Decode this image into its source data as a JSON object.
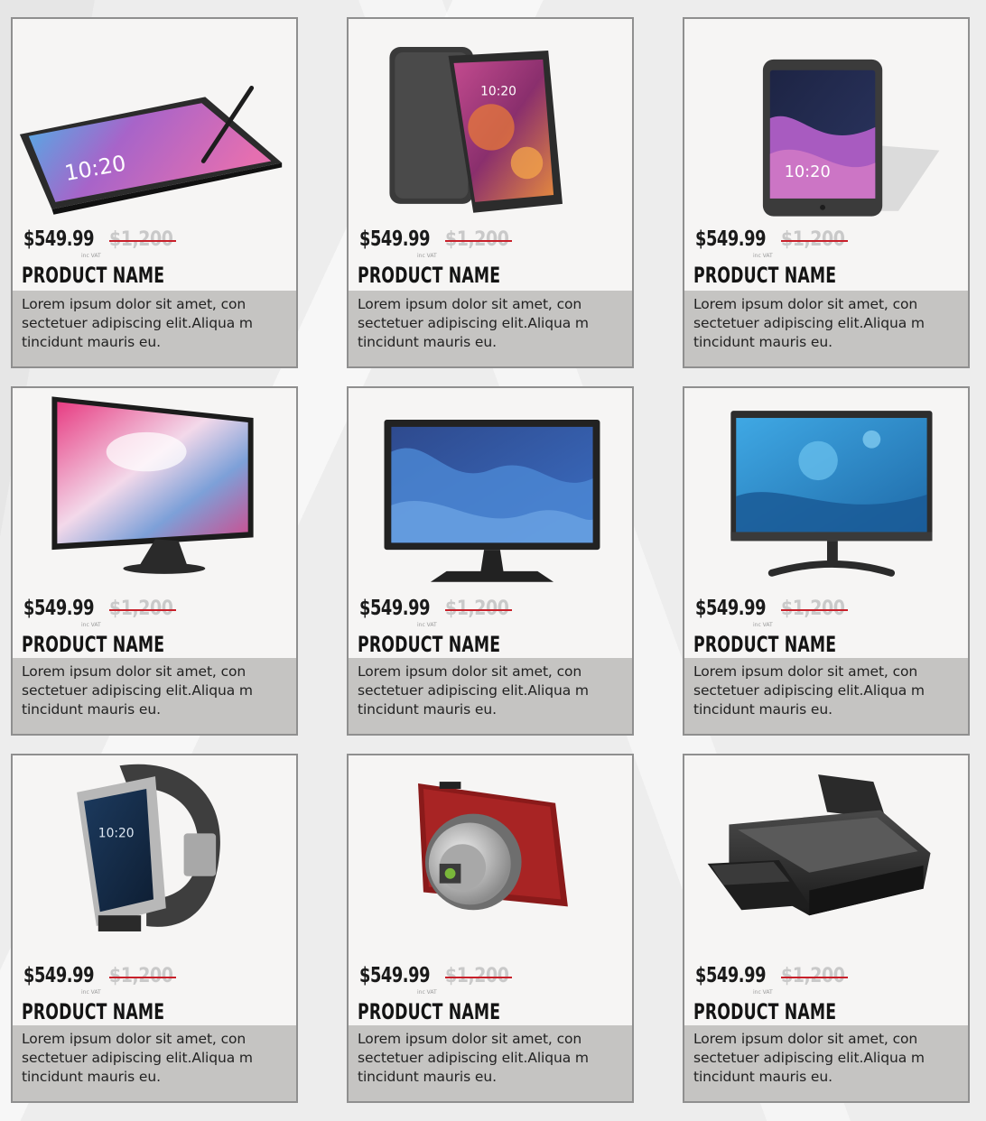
{
  "products": [
    {
      "icon": "tablet-with-stylus-icon",
      "price": "$549.99",
      "old_price": "$1,200",
      "vat": "inc VAT",
      "name": "PRODUCT NAME",
      "description": "Lorem ipsum dolor sit amet, con sectetuer adipiscing elit.Aliqua m tincidunt mauris eu.",
      "screen_time": "10:20"
    },
    {
      "icon": "smartphone-icon",
      "price": "$549.99",
      "old_price": "$1,200",
      "vat": "inc VAT",
      "name": "PRODUCT NAME",
      "description": "Lorem ipsum dolor sit amet, con sectetuer adipiscing elit.Aliqua m tincidunt mauris eu.",
      "screen_time": "10:20"
    },
    {
      "icon": "tablet-icon",
      "price": "$549.99",
      "old_price": "$1,200",
      "vat": "inc VAT",
      "name": "PRODUCT NAME",
      "description": "Lorem ipsum dolor sit amet, con sectetuer adipiscing elit.Aliqua m tincidunt mauris eu.",
      "screen_time": "10:20"
    },
    {
      "icon": "tv-monitor-icon",
      "price": "$549.99",
      "old_price": "$1,200",
      "vat": "inc VAT",
      "name": "PRODUCT NAME",
      "description": "Lorem ipsum dolor sit amet, con sectetuer adipiscing elit.Aliqua m tincidunt mauris eu."
    },
    {
      "icon": "desktop-monitor-icon",
      "price": "$549.99",
      "old_price": "$1,200",
      "vat": "inc VAT",
      "name": "PRODUCT NAME",
      "description": "Lorem ipsum dolor sit amet, con sectetuer adipiscing elit.Aliqua m tincidunt mauris eu."
    },
    {
      "icon": "all-in-one-monitor-icon",
      "price": "$549.99",
      "old_price": "$1,200",
      "vat": "inc VAT",
      "name": "PRODUCT NAME",
      "description": "Lorem ipsum dolor sit amet, con sectetuer adipiscing elit.Aliqua m tincidunt mauris eu."
    },
    {
      "icon": "smartwatch-icon",
      "price": "$549.99",
      "old_price": "$1,200",
      "vat": "inc VAT",
      "name": "PRODUCT NAME",
      "description": "Lorem ipsum dolor sit amet, con sectetuer adipiscing elit.Aliqua m tincidunt mauris eu.",
      "screen_time": "10:20"
    },
    {
      "icon": "camera-icon",
      "price": "$549.99",
      "old_price": "$1,200",
      "vat": "inc VAT",
      "name": "PRODUCT NAME",
      "description": "Lorem ipsum dolor sit amet, con sectetuer adipiscing elit.Aliqua m tincidunt mauris eu."
    },
    {
      "icon": "printer-icon",
      "price": "$549.99",
      "old_price": "$1,200",
      "vat": "inc VAT",
      "name": "PRODUCT NAME",
      "description": "Lorem ipsum dolor sit amet, con sectetuer adipiscing elit.Aliqua m tincidunt mauris eu."
    }
  ],
  "colors": {
    "price": "#1a1a1a",
    "old_price": "#c9c9c9",
    "strike": "#c8202a",
    "card_bg": "#f6f5f4",
    "card_border": "#8f8f8f",
    "desc_bg": "#c5c4c2"
  }
}
